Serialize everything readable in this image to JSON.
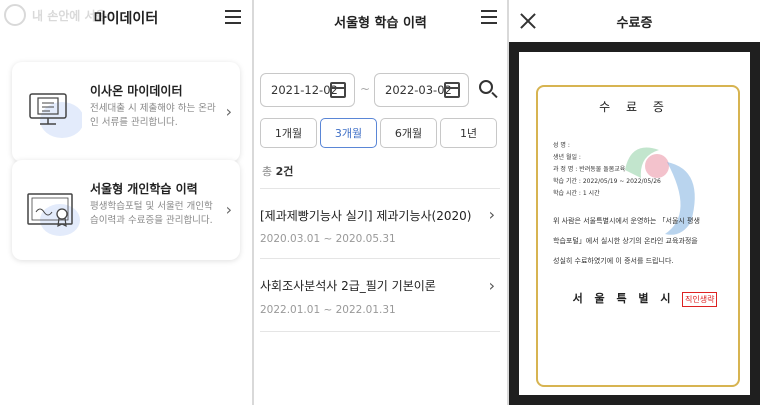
{
  "panel1": {
    "title": "마이데이터",
    "watermark": "내 손안에 서울",
    "cards": [
      {
        "title": "이사온 마이데이터",
        "desc": "전세대출 시 제출해야 하는 온라인 서류를 관리합니다."
      },
      {
        "title": "서울형 개인학습 이력",
        "desc": "평생학습포털 및 서울런 개인학습이력과 수료증을 관리합니다."
      }
    ]
  },
  "panel2": {
    "title": "서울형 학습 이력",
    "date_from": "2021-12-02",
    "date_separator": "~",
    "date_to": "2022-03-02",
    "periods": [
      "1개월",
      "3개월",
      "6개월",
      "1년"
    ],
    "active_period": "3개월",
    "total_label": "총",
    "total_count": "2건",
    "courses": [
      {
        "title": "[제과제빵기능사 실기] 제과기능사(2020)",
        "date": "2020.03.01 ~ 2020.05.31"
      },
      {
        "title": "사회조사분석사 2급_필기 기본이론",
        "date": "2022.01.01 ~ 2022.01.31"
      }
    ]
  },
  "panel3": {
    "title": "수료증",
    "cert_title": "수 료 증",
    "fields": [
      "성      명 :",
      "생년 월일 :",
      "과  정  명 : 반려동물 돌봄교육",
      "학습 기간 : 2022/05/19 ~ 2022/05/26",
      "학습 시간 : 1 시간"
    ],
    "body_lines": [
      "위 사람은 서울특별시에서 운영하는 「서울시 평생",
      "학습포털」에서 실시한 상기의 온라인 교육과정을",
      "성실히 수료하였기에 이 증서를 드립니다."
    ],
    "signature": "서 울 특 별 시 장",
    "stamp": "직인생략"
  },
  "colors": {
    "accent": "#3f6fc6",
    "gold": "#d7b451",
    "stamp": "#dd2222"
  }
}
